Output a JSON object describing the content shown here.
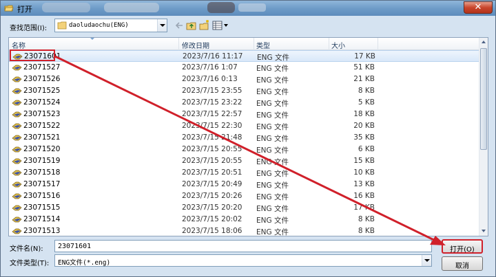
{
  "window": {
    "title": "打开"
  },
  "lookin": {
    "label": "查找范围(I):",
    "value": "daoludaochu(ENG)"
  },
  "columns": {
    "name": "名称",
    "date": "修改日期",
    "type": "类型",
    "size": "大小"
  },
  "files": [
    {
      "name": "23071601",
      "date": "2023/7/16 11:17",
      "type": "ENG 文件",
      "size": "17 KB"
    },
    {
      "name": "23071527",
      "date": "2023/7/16 1:07",
      "type": "ENG 文件",
      "size": "51 KB"
    },
    {
      "name": "23071526",
      "date": "2023/7/16 0:13",
      "type": "ENG 文件",
      "size": "21 KB"
    },
    {
      "name": "23071525",
      "date": "2023/7/15 23:55",
      "type": "ENG 文件",
      "size": "8 KB"
    },
    {
      "name": "23071524",
      "date": "2023/7/15 23:22",
      "type": "ENG 文件",
      "size": "5 KB"
    },
    {
      "name": "23071523",
      "date": "2023/7/15 22:57",
      "type": "ENG 文件",
      "size": "18 KB"
    },
    {
      "name": "23071522",
      "date": "2023/7/15 22:30",
      "type": "ENG 文件",
      "size": "20 KB"
    },
    {
      "name": "23071521",
      "date": "2023/7/15 21:48",
      "type": "ENG 文件",
      "size": "35 KB"
    },
    {
      "name": "23071520",
      "date": "2023/7/15 20:55",
      "type": "ENG 文件",
      "size": "6 KB"
    },
    {
      "name": "23071519",
      "date": "2023/7/15 20:55",
      "type": "ENG 文件",
      "size": "15 KB"
    },
    {
      "name": "23071518",
      "date": "2023/7/15 20:51",
      "type": "ENG 文件",
      "size": "10 KB"
    },
    {
      "name": "23071517",
      "date": "2023/7/15 20:49",
      "type": "ENG 文件",
      "size": "13 KB"
    },
    {
      "name": "23071516",
      "date": "2023/7/15 20:26",
      "type": "ENG 文件",
      "size": "16 KB"
    },
    {
      "name": "23071515",
      "date": "2023/7/15 20:20",
      "type": "ENG 文件",
      "size": "17 KB"
    },
    {
      "name": "23071514",
      "date": "2023/7/15 20:02",
      "type": "ENG 文件",
      "size": "8 KB"
    },
    {
      "name": "23071513",
      "date": "2023/7/15 18:06",
      "type": "ENG 文件",
      "size": "8 KB"
    }
  ],
  "selected_file": "23071601",
  "filename": {
    "label": "文件名(N):",
    "value": "23071601"
  },
  "filetype": {
    "label": "文件类型(T):",
    "value": "ENG文件(*.eng)"
  },
  "buttons": {
    "open": "打开(O)",
    "cancel": "取消"
  },
  "icons": {
    "app": "open-folder-icon",
    "file": "eng-file-icon",
    "close": "close-icon"
  },
  "colors": {
    "annotation": "#d0202a",
    "selection": "#d9e8f9"
  }
}
